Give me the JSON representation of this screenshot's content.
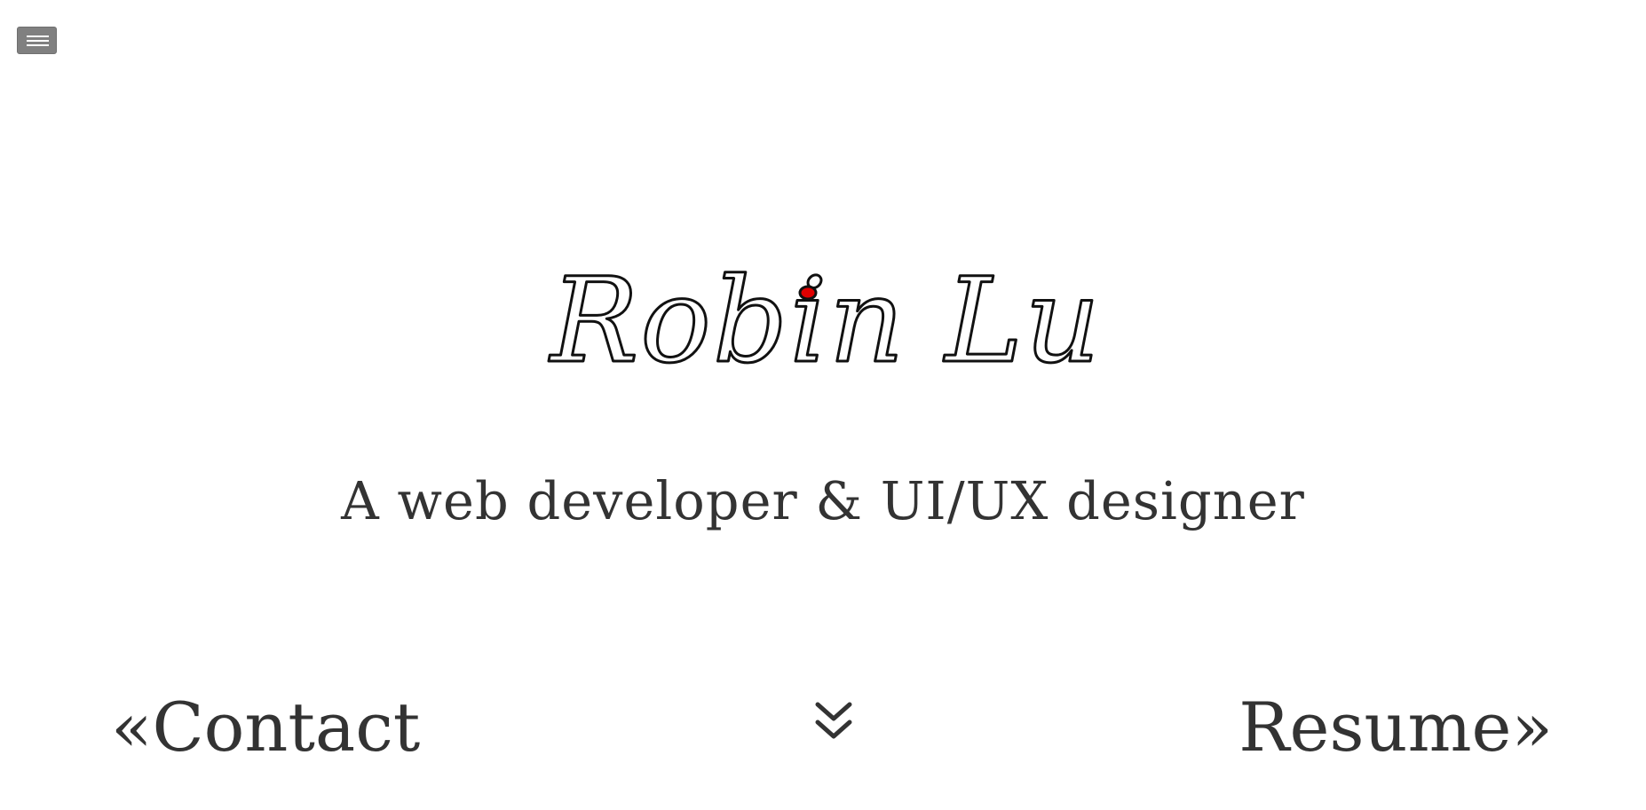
{
  "menu": {
    "icon": "hamburger-menu-icon",
    "button_color": "#808080"
  },
  "hero": {
    "logo_text": "Robin Lu",
    "logo_dot_color": "#e00000",
    "tagline": "A web developer & UI/UX designer"
  },
  "nav": {
    "prev_chevron": "«",
    "prev_label": "Contact",
    "next_label": "Resume",
    "next_chevron": "»",
    "scroll_icon": "double-chevron-down-icon"
  },
  "colors": {
    "text": "#333333",
    "background": "#ffffff"
  }
}
